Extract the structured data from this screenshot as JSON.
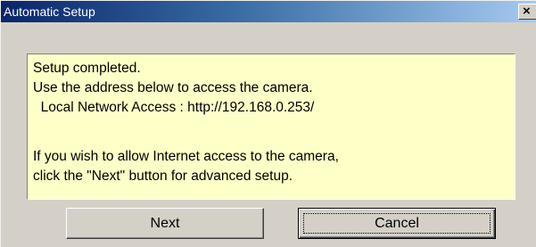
{
  "window": {
    "title": "Automatic Setup",
    "close_glyph": "×"
  },
  "message": {
    "lines": [
      "Setup completed.",
      "Use the address below to access the camera.",
      "  Local Network Access : http://192.168.0.253/",
      "",
      "If you wish to allow Internet access to the camera,",
      "click the \"Next\" button for advanced setup."
    ],
    "background_color": "#ffffc8"
  },
  "buttons": {
    "next_label": "Next",
    "cancel_label": "Cancel"
  },
  "colors": {
    "titlebar_start": "#0a246a",
    "titlebar_end": "#a6caf0",
    "dialog_face": "#d4d0c8"
  }
}
